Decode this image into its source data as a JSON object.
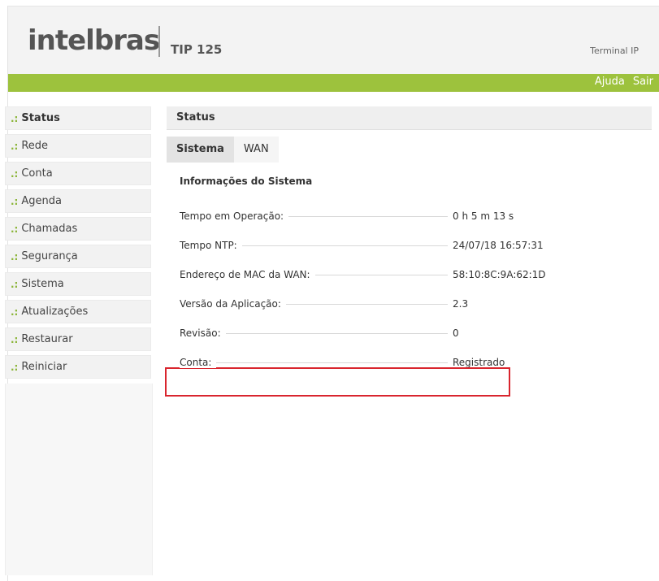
{
  "header": {
    "brand": "intelbras",
    "product": "TIP 125",
    "right_label": "Terminal IP"
  },
  "topnav": {
    "help": "Ajuda",
    "exit": "Sair"
  },
  "colors": {
    "accent": "#9dc23d",
    "highlight_border": "#d9252e"
  },
  "sidebar": {
    "items": [
      {
        "label": "Status",
        "active": true
      },
      {
        "label": "Rede"
      },
      {
        "label": "Conta"
      },
      {
        "label": "Agenda"
      },
      {
        "label": "Chamadas"
      },
      {
        "label": "Segurança"
      },
      {
        "label": "Sistema"
      },
      {
        "label": "Atualizações"
      },
      {
        "label": "Restaurar"
      },
      {
        "label": "Reiniciar"
      }
    ]
  },
  "main": {
    "title": "Status",
    "tabs": [
      {
        "label": "Sistema",
        "active": true
      },
      {
        "label": "WAN"
      }
    ],
    "section_title": "Informações do Sistema",
    "rows": [
      {
        "label": "Tempo em Operação:",
        "value": "0 h 5 m 13 s"
      },
      {
        "label": "Tempo NTP:",
        "value": "24/07/18 16:57:31"
      },
      {
        "label": "Endereço de MAC da WAN:",
        "value": "58:10:8C:9A:62:1D"
      },
      {
        "label": "Versão da Aplicação:",
        "value": "2.3"
      },
      {
        "label": "Revisão:",
        "value": "0"
      },
      {
        "label": "Conta:",
        "value": "Registrado"
      }
    ]
  }
}
